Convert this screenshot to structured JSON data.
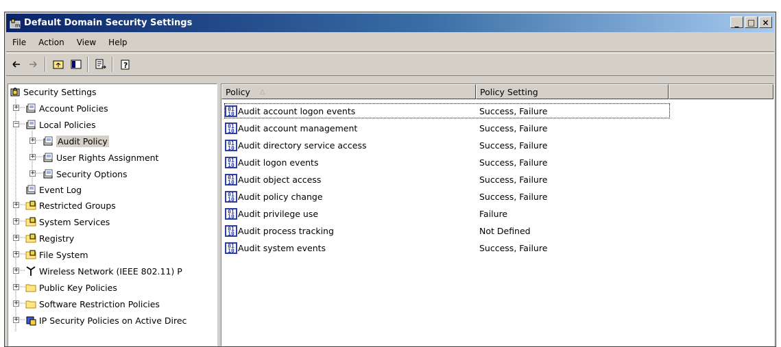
{
  "window": {
    "title": "Default Domain Security Settings",
    "controls": {
      "minimize": "_",
      "maximize": "□",
      "close": "×"
    }
  },
  "menu": [
    "File",
    "Action",
    "View",
    "Help"
  ],
  "toolbar": {
    "icons": [
      "back-arrow-icon",
      "forward-arrow-icon",
      "up-folder-icon",
      "show-hide-tree-icon",
      "export-list-icon",
      "help-icon"
    ]
  },
  "tree": {
    "items": [
      {
        "label": "Security Settings",
        "icon": "security-settings-icon"
      },
      {
        "label": "Account Policies",
        "icon": "policy-folder-icon"
      },
      {
        "label": "Local Policies",
        "icon": "policy-folder-icon"
      },
      {
        "label": "Audit Policy",
        "icon": "policy-folder-icon"
      },
      {
        "label": "User Rights Assignment",
        "icon": "policy-folder-icon"
      },
      {
        "label": "Security Options",
        "icon": "policy-folder-icon"
      },
      {
        "label": "Event Log",
        "icon": "policy-folder-icon"
      },
      {
        "label": "Restricted Groups",
        "icon": "locked-folder-icon"
      },
      {
        "label": "System Services",
        "icon": "locked-folder-icon"
      },
      {
        "label": "Registry",
        "icon": "locked-folder-icon"
      },
      {
        "label": "File System",
        "icon": "locked-folder-icon"
      },
      {
        "label": "Wireless Network (IEEE 802.11) P",
        "icon": "antenna-icon"
      },
      {
        "label": "Public Key Policies",
        "icon": "folder-icon"
      },
      {
        "label": "Software Restriction Policies",
        "icon": "folder-icon"
      },
      {
        "label": "IP Security Policies on Active Direc",
        "icon": "ip-security-icon"
      }
    ]
  },
  "list": {
    "columns": [
      "Policy",
      "Policy Setting",
      ""
    ],
    "sort_indicator": "△",
    "rows": [
      {
        "policy": "Audit account logon events",
        "setting": "Success, Failure"
      },
      {
        "policy": "Audit account management",
        "setting": "Success, Failure"
      },
      {
        "policy": "Audit directory service access",
        "setting": "Success, Failure"
      },
      {
        "policy": "Audit logon events",
        "setting": "Success, Failure"
      },
      {
        "policy": "Audit object access",
        "setting": "Success, Failure"
      },
      {
        "policy": "Audit policy change",
        "setting": "Success, Failure"
      },
      {
        "policy": "Audit privilege use",
        "setting": "Failure"
      },
      {
        "policy": "Audit process tracking",
        "setting": "Not Defined"
      },
      {
        "policy": "Audit system events",
        "setting": "Success, Failure"
      }
    ]
  }
}
